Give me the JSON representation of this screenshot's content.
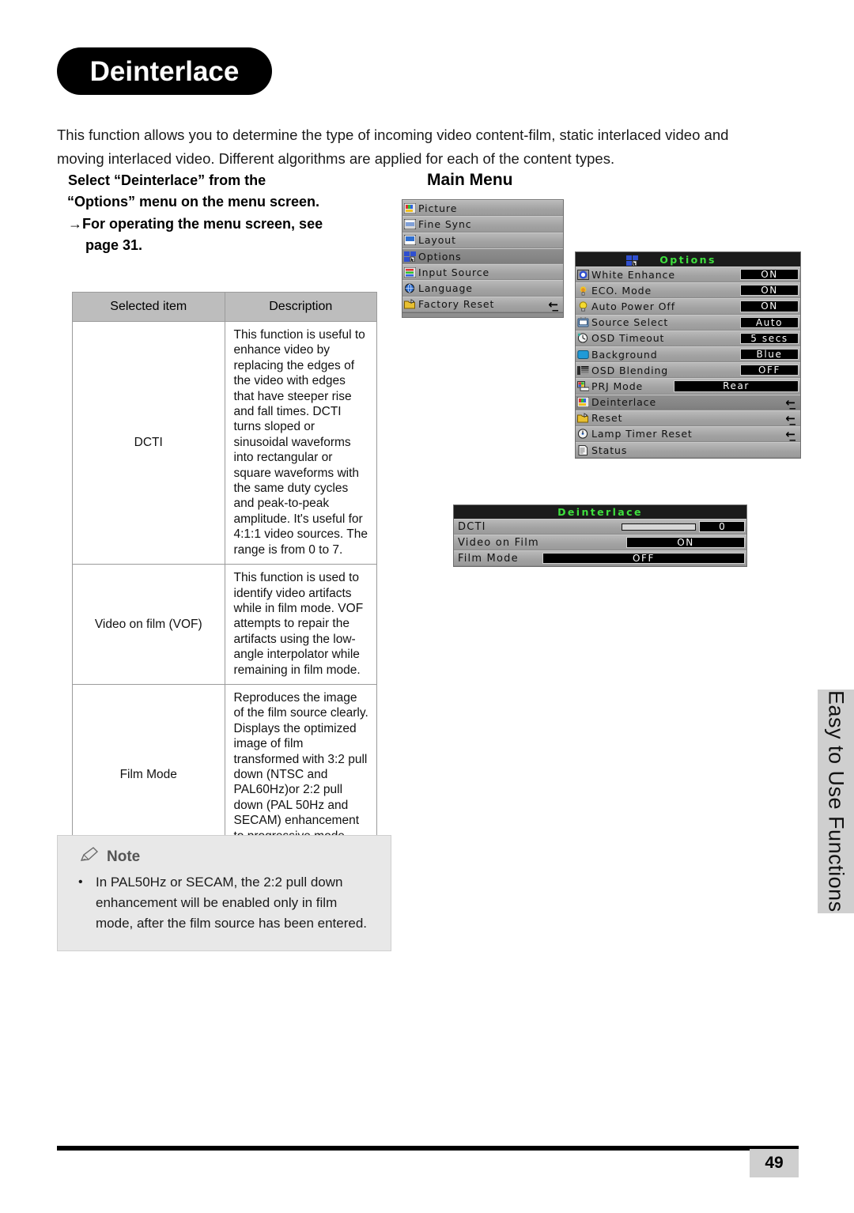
{
  "page": {
    "title": "Deinterlace",
    "number": "49",
    "side_tab": "Easy to Use Functions",
    "intro": "This function allows you to determine the type of incoming video content-film, static interlaced video and moving interlaced video. Different algorithms are applied for each of the content types."
  },
  "instructions": {
    "line1": "Select “Deinterlace” from the",
    "line2": "“Options” menu on the menu screen.",
    "line3": "→For operating the menu screen, see",
    "line4": "page 31."
  },
  "main_menu": {
    "label": "Main Menu",
    "items": [
      {
        "label": "Picture",
        "icon": "picture-icon",
        "selected": false,
        "enter": false
      },
      {
        "label": "Fine Sync",
        "icon": "fine-sync-icon",
        "selected": false,
        "enter": false
      },
      {
        "label": "Layout",
        "icon": "layout-icon",
        "selected": false,
        "enter": false
      },
      {
        "label": "Options",
        "icon": "options-icon",
        "selected": true,
        "enter": false
      },
      {
        "label": "Input Source",
        "icon": "input-source-icon",
        "selected": false,
        "enter": false
      },
      {
        "label": "Language",
        "icon": "language-icon",
        "selected": false,
        "enter": false
      },
      {
        "label": "Factory Reset",
        "icon": "folder-icon",
        "selected": false,
        "enter": true
      }
    ]
  },
  "options_menu": {
    "title": "Options",
    "title_icon": "options-icon",
    "items": [
      {
        "label": "White Enhance",
        "icon": "white-enhance-icon",
        "value": "ON",
        "selected": false,
        "enter": false,
        "wide": false
      },
      {
        "label": "ECO. Mode",
        "icon": "eco-mode-icon",
        "value": "ON",
        "selected": false,
        "enter": false,
        "wide": false
      },
      {
        "label": "Auto Power Off",
        "icon": "bulb-icon",
        "value": "ON",
        "selected": false,
        "enter": false,
        "wide": false
      },
      {
        "label": "Source Select",
        "icon": "source-select-icon",
        "value": "Auto",
        "selected": false,
        "enter": false,
        "wide": false
      },
      {
        "label": "OSD Timeout",
        "icon": "clock-icon",
        "value": "5 secs",
        "selected": false,
        "enter": false,
        "wide": false
      },
      {
        "label": "Background",
        "icon": "background-icon",
        "value": "Blue",
        "selected": false,
        "enter": false,
        "wide": false
      },
      {
        "label": "OSD Blending",
        "icon": "osd-blending-icon",
        "value": "OFF",
        "selected": false,
        "enter": false,
        "wide": false
      },
      {
        "label": "PRJ Mode",
        "icon": "prj-mode-icon",
        "value": "Rear",
        "selected": false,
        "enter": false,
        "wide": true
      },
      {
        "label": "Deinterlace",
        "icon": "picture-icon",
        "value": "",
        "selected": true,
        "enter": true,
        "wide": false
      },
      {
        "label": "Reset",
        "icon": "folder-icon",
        "value": "",
        "selected": false,
        "enter": true,
        "wide": false
      },
      {
        "label": "Lamp Timer Reset",
        "icon": "clock-icon",
        "value": "",
        "selected": false,
        "enter": true,
        "wide": false
      },
      {
        "label": "Status",
        "icon": "status-icon",
        "value": "",
        "selected": false,
        "enter": false,
        "wide": false
      }
    ]
  },
  "deinterlace_menu": {
    "title": "Deinterlace",
    "rows": {
      "dcti_label": "DCTI",
      "dcti_value": "0",
      "vof_label": "Video on Film",
      "vof_value": "ON",
      "film_label": "Film Mode",
      "film_value": "OFF"
    }
  },
  "table": {
    "headers": [
      "Selected item",
      "Description"
    ],
    "rows": [
      {
        "item": "DCTI",
        "description": "This function is useful to enhance video by replacing the edges of the video with edges that have steeper rise and fall times. DCTI turns sloped or sinusoidal waveforms into rectangular or square waveforms with the same duty cycles and peak-to-peak amplitude. It's useful for 4:1:1 video sources. The range is from 0 to 7."
      },
      {
        "item": "Video on film (VOF)",
        "description": "This function is used to identify video artifacts while in film mode. VOF attempts to repair the artifacts using the low-angle interpolator while remaining in film mode."
      },
      {
        "item": "Film Mode",
        "description": "Reproduces the image of the film source clearly. Displays the optimized image of film transformed with 3:2 pull down (NTSC and PAL60Hz)or 2:2 pull down (PAL 50Hz and SECAM) enhancement to progressive mode images."
      }
    ]
  },
  "note": {
    "heading": "Note",
    "icon": "pencil-icon",
    "bullet": "•",
    "text": "In PAL50Hz or SECAM, the 2:2 pull down enhancement will be enabled only in film mode, after the film source has been entered."
  },
  "colors": {
    "osd_green": "#3ee03e",
    "osd_bg": "#a7a7a7",
    "osd_header": "#1b1b1b",
    "table_header": "#bdbdbd",
    "note_bg": "#e8e8e8",
    "tab_bg": "#cfcfcf"
  }
}
